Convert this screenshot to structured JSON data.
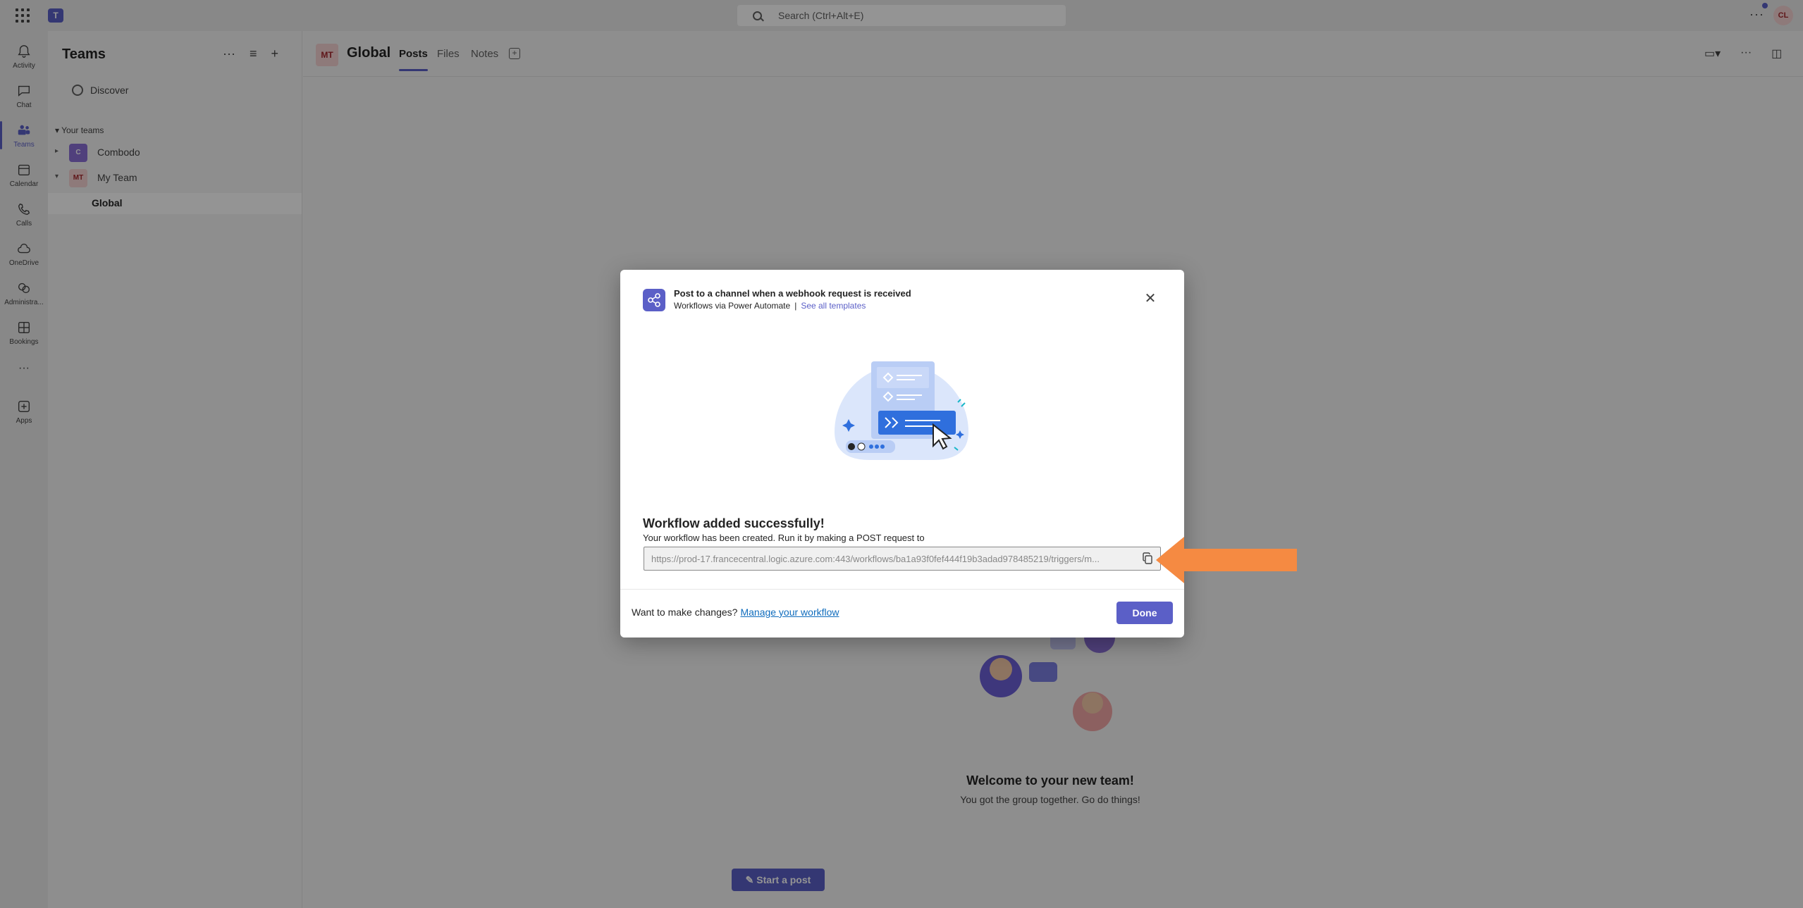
{
  "titlebar": {
    "search_placeholder": "Search (Ctrl+Alt+E)",
    "more_label": "···",
    "avatar_initials": "CL"
  },
  "rail": {
    "items": [
      {
        "label": "Activity",
        "icon": "bell-icon"
      },
      {
        "label": "Chat",
        "icon": "chat-icon"
      },
      {
        "label": "Teams",
        "icon": "teams-icon"
      },
      {
        "label": "Calendar",
        "icon": "calendar-icon"
      },
      {
        "label": "Calls",
        "icon": "phone-icon"
      },
      {
        "label": "OneDrive",
        "icon": "cloud-icon"
      },
      {
        "label": "Administra...",
        "icon": "admin-icon"
      },
      {
        "label": "Bookings",
        "icon": "bookings-icon"
      },
      {
        "label": "···",
        "icon": "more-icon"
      },
      {
        "label": "Apps",
        "icon": "apps-icon"
      }
    ]
  },
  "teams_panel": {
    "title": "Teams",
    "discover_label": "Discover",
    "your_teams_label": "Your teams",
    "teams": [
      {
        "name": "Combodo",
        "initials": "C"
      },
      {
        "name": "My Team",
        "initials": "MT"
      }
    ],
    "channel": "Global"
  },
  "main_header": {
    "initials": "MT",
    "title": "Global",
    "tabs": [
      "Posts",
      "Files",
      "Notes"
    ]
  },
  "welcome": {
    "title": "Welcome to your new team!",
    "subtitle": "You got the group together. Go do things!",
    "start_post": "Start a post"
  },
  "dialog": {
    "title": "Post to a channel when a webhook request is received",
    "source": "Workflows via Power Automate",
    "see_all": "See all templates",
    "heading": "Workflow added successfully!",
    "body": "Your workflow has been created. Run it by making a POST request to",
    "url": "https://prod-17.francecentral.logic.azure.com:443/workflows/ba1a93f0fef444f19b3adad978485219/triggers/m...",
    "footer_text": "Want to make changes?",
    "footer_link": "Manage your workflow",
    "done_label": "Done"
  },
  "colors": {
    "accent": "#5b5fc7",
    "arrow": "#f58a42",
    "link": "#0f6cbd"
  }
}
